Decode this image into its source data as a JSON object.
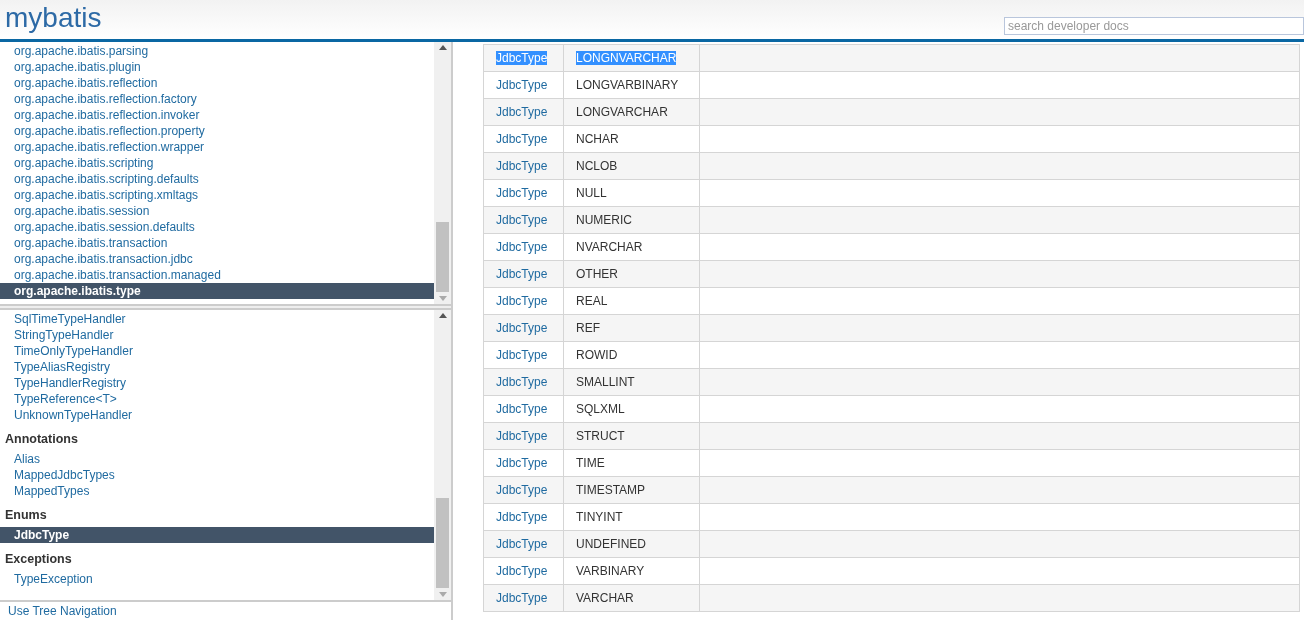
{
  "header": {
    "logo": "mybatis",
    "search": {
      "placeholder": "search developer docs"
    }
  },
  "packages": [
    {
      "label": "org.apache.ibatis.parsing",
      "selected": false
    },
    {
      "label": "org.apache.ibatis.plugin",
      "selected": false
    },
    {
      "label": "org.apache.ibatis.reflection",
      "selected": false
    },
    {
      "label": "org.apache.ibatis.reflection.factory",
      "selected": false
    },
    {
      "label": "org.apache.ibatis.reflection.invoker",
      "selected": false
    },
    {
      "label": "org.apache.ibatis.reflection.property",
      "selected": false
    },
    {
      "label": "org.apache.ibatis.reflection.wrapper",
      "selected": false
    },
    {
      "label": "org.apache.ibatis.scripting",
      "selected": false
    },
    {
      "label": "org.apache.ibatis.scripting.defaults",
      "selected": false
    },
    {
      "label": "org.apache.ibatis.scripting.xmltags",
      "selected": false
    },
    {
      "label": "org.apache.ibatis.session",
      "selected": false
    },
    {
      "label": "org.apache.ibatis.session.defaults",
      "selected": false
    },
    {
      "label": "org.apache.ibatis.transaction",
      "selected": false
    },
    {
      "label": "org.apache.ibatis.transaction.jdbc",
      "selected": false
    },
    {
      "label": "org.apache.ibatis.transaction.managed",
      "selected": false
    },
    {
      "label": "org.apache.ibatis.type",
      "selected": true
    }
  ],
  "classes": [
    {
      "kind": "group",
      "items": [
        {
          "label": "SqlTimeTypeHandler",
          "selected": false
        },
        {
          "label": "StringTypeHandler",
          "selected": false
        },
        {
          "label": "TimeOnlyTypeHandler",
          "selected": false
        },
        {
          "label": "TypeAliasRegistry",
          "selected": false
        },
        {
          "label": "TypeHandlerRegistry",
          "selected": false
        },
        {
          "label": "TypeReference<T>",
          "selected": false
        },
        {
          "label": "UnknownTypeHandler",
          "selected": false
        }
      ]
    },
    {
      "kind": "group",
      "heading": "Annotations",
      "items": [
        {
          "label": "Alias",
          "selected": false
        },
        {
          "label": "MappedJdbcTypes",
          "selected": false
        },
        {
          "label": "MappedTypes",
          "selected": false
        }
      ]
    },
    {
      "kind": "group",
      "heading": "Enums",
      "items": [
        {
          "label": "JdbcType",
          "selected": true
        }
      ]
    },
    {
      "kind": "group",
      "heading": "Exceptions",
      "items": [
        {
          "label": "TypeException",
          "selected": false
        }
      ]
    }
  ],
  "tree_link": "Use Tree Navigation",
  "table": {
    "rows": [
      {
        "type": "JdbcType",
        "value": "LONGNVARCHAR",
        "highlighted": true
      },
      {
        "type": "JdbcType",
        "value": "LONGVARBINARY",
        "highlighted": false
      },
      {
        "type": "JdbcType",
        "value": "LONGVARCHAR",
        "highlighted": false
      },
      {
        "type": "JdbcType",
        "value": "NCHAR",
        "highlighted": false
      },
      {
        "type": "JdbcType",
        "value": "NCLOB",
        "highlighted": false
      },
      {
        "type": "JdbcType",
        "value": "NULL",
        "highlighted": false
      },
      {
        "type": "JdbcType",
        "value": "NUMERIC",
        "highlighted": false
      },
      {
        "type": "JdbcType",
        "value": "NVARCHAR",
        "highlighted": false
      },
      {
        "type": "JdbcType",
        "value": "OTHER",
        "highlighted": false
      },
      {
        "type": "JdbcType",
        "value": "REAL",
        "highlighted": false
      },
      {
        "type": "JdbcType",
        "value": "REF",
        "highlighted": false
      },
      {
        "type": "JdbcType",
        "value": "ROWID",
        "highlighted": false
      },
      {
        "type": "JdbcType",
        "value": "SMALLINT",
        "highlighted": false
      },
      {
        "type": "JdbcType",
        "value": "SQLXML",
        "highlighted": false
      },
      {
        "type": "JdbcType",
        "value": "STRUCT",
        "highlighted": false
      },
      {
        "type": "JdbcType",
        "value": "TIME",
        "highlighted": false
      },
      {
        "type": "JdbcType",
        "value": "TIMESTAMP",
        "highlighted": false
      },
      {
        "type": "JdbcType",
        "value": "TINYINT",
        "highlighted": false
      },
      {
        "type": "JdbcType",
        "value": "UNDEFINED",
        "highlighted": false
      },
      {
        "type": "JdbcType",
        "value": "VARBINARY",
        "highlighted": false
      },
      {
        "type": "JdbcType",
        "value": "VARCHAR",
        "highlighted": false
      }
    ]
  }
}
